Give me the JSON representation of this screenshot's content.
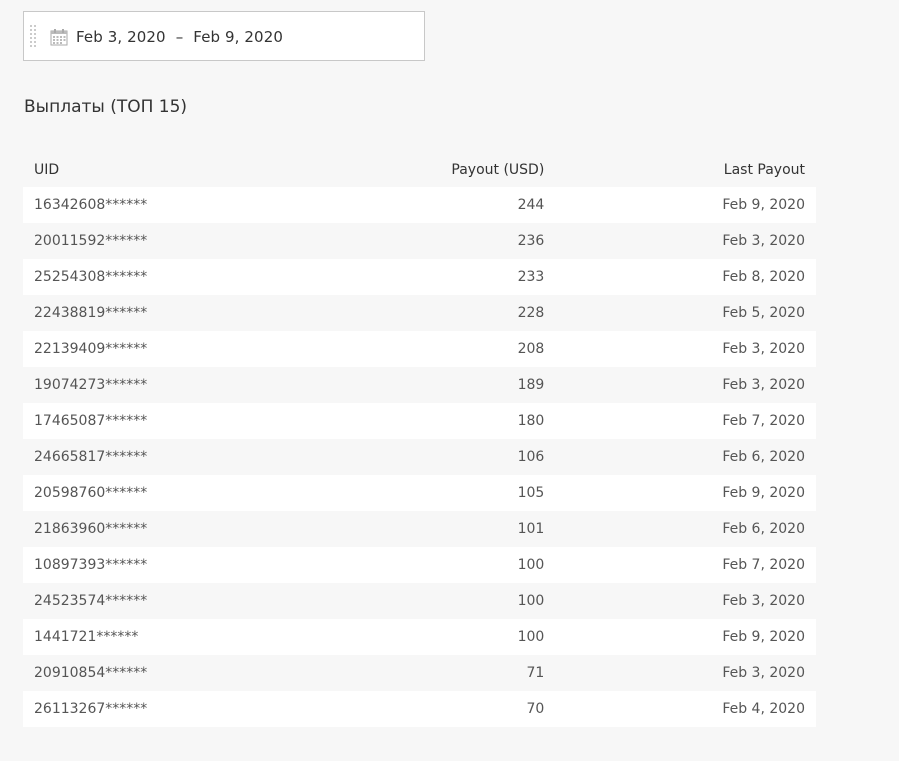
{
  "date_range": {
    "start": "Feb 3, 2020",
    "separator": "–",
    "end": "Feb 9, 2020"
  },
  "section": {
    "title": "Выплаты (ТОП 15)"
  },
  "table": {
    "headers": {
      "uid": "UID",
      "payout": "Payout (USD)",
      "last_payout": "Last Payout"
    },
    "rows": [
      {
        "uid": "16342608******",
        "payout": "244",
        "last_payout": "Feb 9, 2020"
      },
      {
        "uid": "20011592******",
        "payout": "236",
        "last_payout": "Feb 3, 2020"
      },
      {
        "uid": "25254308******",
        "payout": "233",
        "last_payout": "Feb 8, 2020"
      },
      {
        "uid": "22438819******",
        "payout": "228",
        "last_payout": "Feb 5, 2020"
      },
      {
        "uid": "22139409******",
        "payout": "208",
        "last_payout": "Feb 3, 2020"
      },
      {
        "uid": "19074273******",
        "payout": "189",
        "last_payout": "Feb 3, 2020"
      },
      {
        "uid": "17465087******",
        "payout": "180",
        "last_payout": "Feb 7, 2020"
      },
      {
        "uid": "24665817******",
        "payout": "106",
        "last_payout": "Feb 6, 2020"
      },
      {
        "uid": "20598760******",
        "payout": "105",
        "last_payout": "Feb 9, 2020"
      },
      {
        "uid": "21863960******",
        "payout": "101",
        "last_payout": "Feb 6, 2020"
      },
      {
        "uid": "10897393******",
        "payout": "100",
        "last_payout": "Feb 7, 2020"
      },
      {
        "uid": "24523574******",
        "payout": "100",
        "last_payout": "Feb 3, 2020"
      },
      {
        "uid": "1441721******",
        "payout": "100",
        "last_payout": "Feb 9, 2020"
      },
      {
        "uid": "20910854******",
        "payout": "71",
        "last_payout": "Feb 3, 2020"
      },
      {
        "uid": "26113267******",
        "payout": "70",
        "last_payout": "Feb 4, 2020"
      }
    ]
  }
}
